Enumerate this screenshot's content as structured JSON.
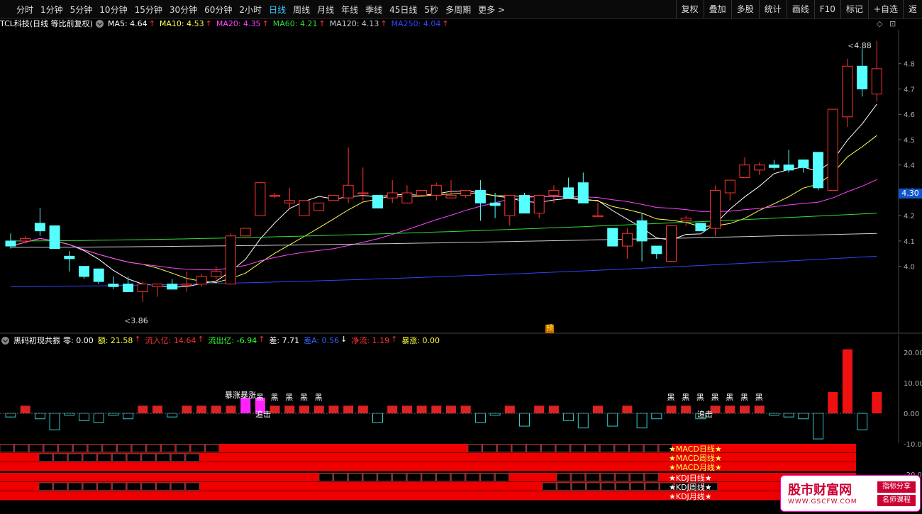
{
  "toolbar": {
    "periods": [
      "分时",
      "1分钟",
      "5分钟",
      "10分钟",
      "15分钟",
      "30分钟",
      "60分钟",
      "2小时",
      "日线",
      "周线",
      "月线",
      "年线",
      "季线",
      "45日线",
      "5秒",
      "多周期",
      "更多 >"
    ],
    "active_index": 8,
    "actions": [
      "复权",
      "叠加",
      "多股",
      "统计",
      "画线",
      "F10",
      "标记",
      "+自选",
      "返"
    ]
  },
  "main_legend": {
    "title": "TCL科技(日线 等比前复权)",
    "ma": [
      {
        "label": "MA5: 4.64",
        "color": "#ffffff"
      },
      {
        "label": "MA10: 4.53",
        "color": "#ffff55"
      },
      {
        "label": "MA20: 4.35",
        "color": "#ff44ff"
      },
      {
        "label": "MA60: 4.21",
        "color": "#33dd33"
      },
      {
        "label": "MA120: 4.13",
        "color": "#cccccc"
      },
      {
        "label": "MA250: 4.04",
        "color": "#3344ff"
      }
    ],
    "arrow": "↑"
  },
  "price_axis": [
    "4.8",
    "4.7",
    "4.6",
    "4.5",
    "4.4",
    "4.3",
    "4.2",
    "4.1",
    "4.0"
  ],
  "current_price": "4.30",
  "high_label": "4.88",
  "low_label": "3.86",
  "pre_marker": "预",
  "indicator": {
    "name": "黑码初现共振",
    "items": [
      {
        "label": "零: 0.00",
        "color": "#ffffff"
      },
      {
        "label": "额: 21.58",
        "color": "#ffff33"
      },
      {
        "label": "流入亿: 14.64",
        "color": "#ff3333"
      },
      {
        "label": "流出亿: -6.94",
        "color": "#33ff33"
      },
      {
        "label": "差: 7.71",
        "color": "#ffffff"
      },
      {
        "label": "差A: 0.56",
        "color": "#3366ff"
      },
      {
        "label": "净流: 1.19",
        "color": "#ff3333"
      },
      {
        "label": "暴涨: 0.00",
        "color": "#ffff33"
      }
    ],
    "arrows": [
      "",
      "↑",
      "↑",
      "↑",
      "",
      "↓",
      "↑",
      ""
    ],
    "axis": [
      "20.00",
      "10.00",
      "0.00",
      "-10.00",
      "-20.00"
    ],
    "dark_mark": "黑",
    "chase_text": "追击",
    "surge_text": "暴涨暴涨"
  },
  "strips": [
    "★MACD日线★",
    "★MACD周线★",
    "★MACD月线★",
    "★KDJ日线★",
    "★KDJ周线★",
    "★KDJ月线★"
  ],
  "watermark": {
    "main": "股市财富网",
    "url": "WWW.GSCFW.COM",
    "badge1": "指标分享",
    "badge2": "名师课程"
  },
  "colors": {
    "up": "#ff3333",
    "down": "#55ffff",
    "bg": "#000000",
    "strip_red": "#ee0000"
  },
  "chart_data": {
    "type": "candlestick",
    "title": "TCL科技(日线 等比前复权)",
    "candles": [
      [
        4.1,
        4.13,
        4.07,
        4.08
      ],
      [
        4.1,
        4.12,
        4.09,
        4.11
      ],
      [
        4.17,
        4.23,
        4.12,
        4.14
      ],
      [
        4.16,
        4.16,
        4.07,
        4.07
      ],
      [
        4.04,
        4.06,
        3.98,
        4.03
      ],
      [
        4.0,
        4.0,
        3.95,
        3.96
      ],
      [
        3.99,
        3.99,
        3.93,
        3.94
      ],
      [
        3.93,
        3.96,
        3.91,
        3.92
      ],
      [
        3.93,
        3.96,
        3.9,
        3.9
      ],
      [
        3.9,
        3.94,
        3.86,
        3.93
      ],
      [
        3.92,
        3.93,
        3.88,
        3.93
      ],
      [
        3.93,
        3.95,
        3.91,
        3.91
      ],
      [
        3.93,
        3.98,
        3.9,
        3.93
      ],
      [
        3.93,
        3.97,
        3.92,
        3.96
      ],
      [
        3.96,
        4.0,
        3.95,
        3.98
      ],
      [
        3.93,
        4.13,
        3.93,
        4.12
      ],
      [
        4.12,
        4.15,
        4.12,
        4.15
      ],
      [
        4.2,
        4.33,
        4.2,
        4.33
      ],
      [
        4.28,
        4.29,
        4.27,
        4.28
      ],
      [
        4.25,
        4.31,
        4.23,
        4.26
      ],
      [
        4.2,
        4.26,
        4.2,
        4.26
      ],
      [
        4.22,
        4.25,
        4.22,
        4.25
      ],
      [
        4.26,
        4.28,
        4.26,
        4.28
      ],
      [
        4.27,
        4.47,
        4.25,
        4.32
      ],
      [
        4.29,
        4.39,
        4.26,
        4.29
      ],
      [
        4.28,
        4.26,
        4.25,
        4.23
      ],
      [
        4.27,
        4.34,
        4.25,
        4.29
      ],
      [
        4.25,
        4.32,
        4.28,
        4.29
      ],
      [
        4.28,
        4.3,
        4.28,
        4.3
      ],
      [
        4.28,
        4.33,
        4.26,
        4.32
      ],
      [
        4.27,
        4.34,
        4.27,
        4.28
      ],
      [
        4.28,
        4.3,
        4.27,
        4.3
      ],
      [
        4.3,
        4.34,
        4.18,
        4.25
      ],
      [
        4.25,
        4.29,
        4.19,
        4.24
      ],
      [
        4.2,
        4.25,
        4.16,
        4.28
      ],
      [
        4.28,
        4.29,
        4.21,
        4.21
      ],
      [
        4.21,
        4.26,
        4.19,
        4.28
      ],
      [
        4.28,
        4.32,
        4.25,
        4.3
      ],
      [
        4.31,
        4.35,
        4.3,
        4.27
      ],
      [
        4.33,
        4.37,
        4.25,
        4.25
      ],
      [
        4.2,
        4.25,
        4.2,
        4.2
      ],
      [
        4.15,
        4.15,
        4.09,
        4.08
      ],
      [
        4.08,
        4.15,
        4.03,
        4.13
      ],
      [
        4.18,
        4.21,
        4.02,
        4.1
      ],
      [
        4.08,
        4.08,
        4.03,
        4.05
      ],
      [
        4.02,
        4.16,
        4.03,
        4.16
      ],
      [
        4.18,
        4.2,
        4.16,
        4.19
      ],
      [
        4.17,
        4.17,
        4.14,
        4.14
      ],
      [
        4.15,
        4.32,
        4.12,
        4.3
      ],
      [
        4.29,
        4.34,
        4.26,
        4.34
      ],
      [
        4.35,
        4.43,
        4.35,
        4.4
      ],
      [
        4.38,
        4.41,
        4.36,
        4.4
      ],
      [
        4.4,
        4.42,
        4.38,
        4.39
      ],
      [
        4.4,
        4.46,
        4.37,
        4.38
      ],
      [
        4.42,
        4.4,
        4.37,
        4.39
      ],
      [
        4.45,
        4.43,
        4.3,
        4.31
      ],
      [
        4.3,
        4.62,
        4.3,
        4.62
      ],
      [
        4.59,
        4.82,
        4.55,
        4.79
      ],
      [
        4.79,
        4.86,
        4.67,
        4.7
      ],
      [
        4.68,
        4.89,
        4.65,
        4.78
      ]
    ],
    "ma_series_names": [
      "MA5",
      "MA10",
      "MA20",
      "MA60",
      "MA120",
      "MA250"
    ]
  }
}
